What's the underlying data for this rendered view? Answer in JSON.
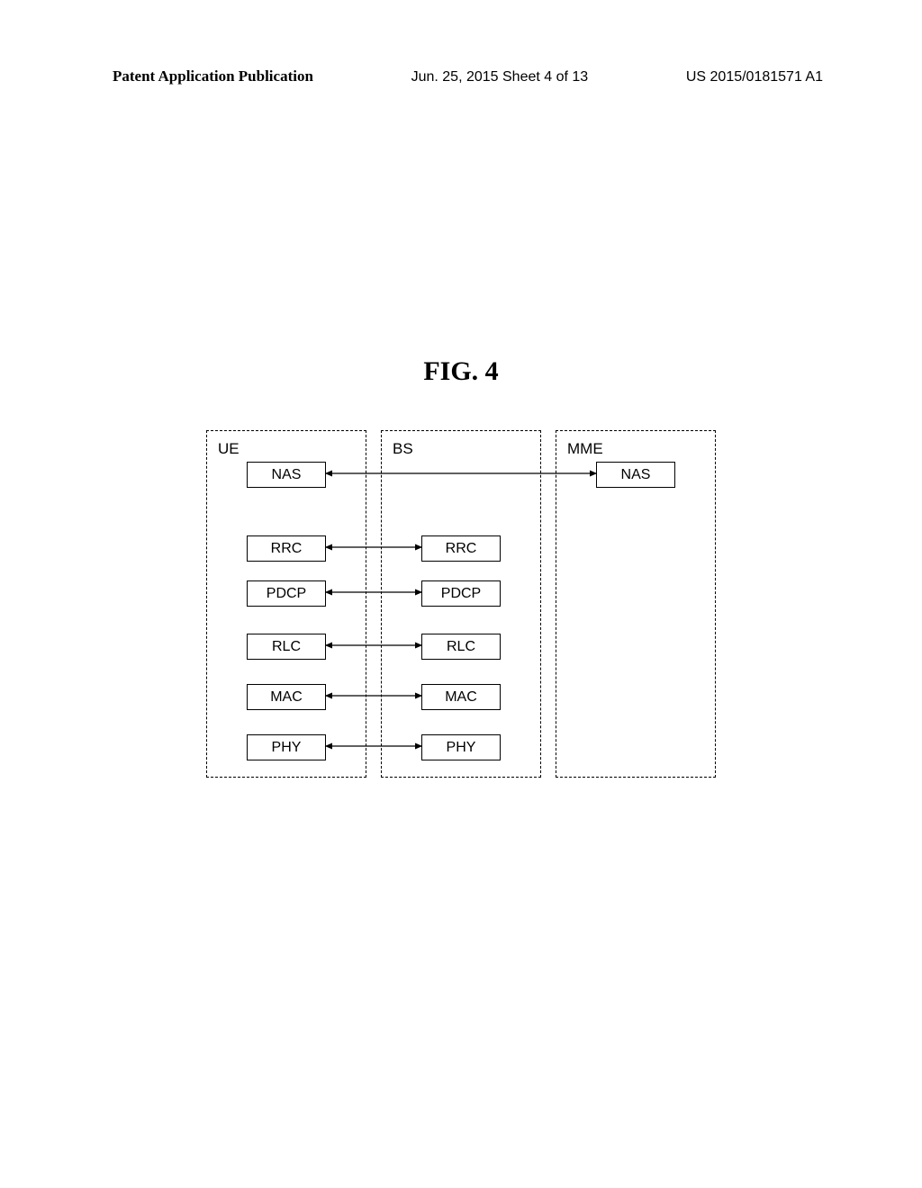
{
  "header": {
    "left": "Patent Application Publication",
    "center": "Jun. 25, 2015  Sheet 4 of 13",
    "right": "US 2015/0181571 A1"
  },
  "figure": {
    "title": "FIG. 4"
  },
  "entities": {
    "ue": {
      "label": "UE"
    },
    "bs": {
      "label": "BS"
    },
    "mme": {
      "label": "MME"
    }
  },
  "layers": {
    "nas": "NAS",
    "rrc": "RRC",
    "pdcp": "PDCP",
    "rlc": "RLC",
    "mac": "MAC",
    "phy": "PHY"
  }
}
